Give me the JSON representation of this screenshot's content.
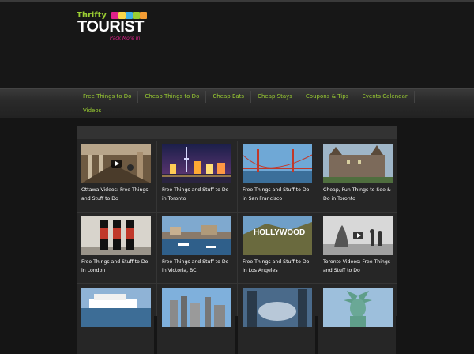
{
  "logo": {
    "line1": "Thrifty",
    "line2": "TOURIST",
    "tagline": "Pack More In"
  },
  "colors": {
    "accent": "#9acd32",
    "tagline": "#e0218a",
    "background": "#151515"
  },
  "nav": {
    "row1": [
      "Free Things to Do",
      "Cheap Things to Do",
      "Cheap Eats",
      "Cheap Stays",
      "Coupons & Tips",
      "Events Calendar"
    ],
    "row2": [
      "Videos"
    ]
  },
  "posts": [
    {
      "title": "Ottawa Videos: Free Things and Stuff to Do",
      "thumb": "indoor-hall-video-thumbnail",
      "video": true
    },
    {
      "title": "Free Things and Stuff to Do in Toronto",
      "thumb": "toronto-night-skyline",
      "video": false
    },
    {
      "title": "Free Things and Stuff to Do in San Francisco",
      "thumb": "golden-gate-bridge",
      "video": false
    },
    {
      "title": "Cheap, Fun Things to See & Do in Toronto",
      "thumb": "castle-building",
      "video": false
    },
    {
      "title": "Free Things and Stuff to Do in London",
      "thumb": "london-guards",
      "video": false
    },
    {
      "title": "Free Things and Stuff to Do in Victoria, BC",
      "thumb": "victoria-harbour",
      "video": false
    },
    {
      "title": "Free Things and Stuff to Do in Los Angeles",
      "thumb": "hollywood-sign",
      "video": false
    },
    {
      "title": "Toronto Videos: Free Things and Stuff to Do",
      "thumb": "sculpture-gallery-video-thumbnail",
      "video": true
    },
    {
      "title": "",
      "thumb": "cruise-ship",
      "video": false
    },
    {
      "title": "",
      "thumb": "city-skyline",
      "video": false
    },
    {
      "title": "",
      "thumb": "chicago-bean",
      "video": false
    },
    {
      "title": "",
      "thumb": "statue-of-liberty",
      "video": false
    }
  ]
}
